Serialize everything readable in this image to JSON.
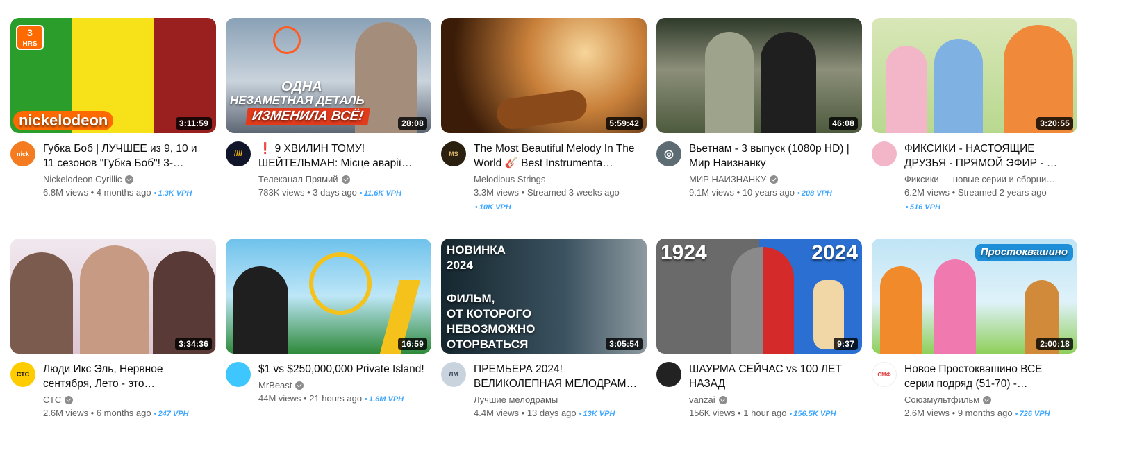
{
  "videos": [
    {
      "title": "Губка Боб | ЛУЧШЕЕ из 9, 10 и 11 сезонов \"Губка Боб\"! 3-…",
      "channel": "Nickelodeon Cyrillic",
      "verified": true,
      "views": "6.8M views",
      "age": "4 months ago",
      "vph": "1.3K VPH",
      "duration": "3:11:59",
      "overlay": [
        "3",
        "HRS",
        "nickelodeon"
      ],
      "avatar_text": "nick",
      "avatar_color": "#f47b20",
      "thumb_colors": [
        "#2a9d2a",
        "#f7e21a",
        "#9a1f1f"
      ]
    },
    {
      "title": "❗ 9 ХВИЛИН ТОМУ! ШЕЙТЕЛЬМАН: Місце аварії…",
      "channel": "Телеканал Прямий",
      "verified": true,
      "views": "783K views",
      "age": "3 days ago",
      "vph": "11.6K VPH",
      "duration": "28:08",
      "overlay": [
        "ОДНА",
        "НЕЗАМЕТНАЯ ДЕТАЛЬ",
        "ИЗМЕНИЛА ВСЁ!"
      ],
      "avatar_text": "////",
      "avatar_color": "#10152a",
      "thumb_colors": [
        "#8aa1b6",
        "#c9d3dc",
        "#e23b1c"
      ]
    },
    {
      "title": "The Most Beautiful Melody In The World 🎸 Best Instrumenta…",
      "channel": "Melodious Strings",
      "verified": false,
      "views": "3.3M views",
      "age": "Streamed 3 weeks ago",
      "vph": "10K VPH",
      "duration": "5:59:42",
      "overlay": [],
      "avatar_text": "MS",
      "avatar_color": "#2b1f0f",
      "thumb_colors": [
        "#3a1c08",
        "#c9803a",
        "#f6d59a"
      ]
    },
    {
      "title": "Вьетнам - 3 выпуск (1080p HD) | Мир Наизнанку",
      "channel": "МИР НАИЗНАНКУ",
      "verified": true,
      "views": "9.1M views",
      "age": "10 years ago",
      "vph": "208 VPH",
      "duration": "46:08",
      "overlay": [],
      "avatar_text": "◎",
      "avatar_color": "#5d6b72",
      "thumb_colors": [
        "#4d5a3d",
        "#8c8f7a",
        "#2f3a2a"
      ]
    },
    {
      "title": "ФИКСИКИ - НАСТОЯЩИЕ ДРУЗЬЯ - ПРЯМОЙ ЭФИР - …",
      "channel": "Фиксики — новые серии и сборни…",
      "verified": false,
      "views": "6.2M views",
      "age": "Streamed 2 years ago",
      "vph": "516 VPH",
      "duration": "3:20:55",
      "overlay": [],
      "avatar_text": "",
      "avatar_color": "#f3b6c9",
      "thumb_colors": [
        "#d9e7b8",
        "#7fb2e3",
        "#f08a3a"
      ]
    },
    {
      "title": "Люди Икс Эль, Нервное сентября, Лето - это…",
      "channel": "СТС",
      "verified": true,
      "views": "2.6M views",
      "age": "6 months ago",
      "vph": "247 VPH",
      "duration": "3:34:36",
      "overlay": [],
      "avatar_text": "СТС",
      "avatar_color": "#ffcc00",
      "thumb_colors": [
        "#f1e8ef",
        "#c79a84",
        "#7a5b4e"
      ]
    },
    {
      "title": "$1 vs $250,000,000 Private Island!",
      "channel": "MrBeast",
      "verified": true,
      "views": "44M views",
      "age": "21 hours ago",
      "vph": "1.6M VPH",
      "duration": "16:59",
      "overlay": [],
      "avatar_text": "",
      "avatar_color": "#3ec6ff",
      "thumb_colors": [
        "#6fc2ec",
        "#2f8a3a",
        "#f4c21a"
      ]
    },
    {
      "title": "ПРЕМЬЕРА 2024! ВЕЛИКОЛЕПНАЯ МЕЛОДРАМ…",
      "channel": "Лучшие мелодрамы",
      "verified": false,
      "views": "4.4M views",
      "age": "13 days ago",
      "vph": "13K VPH",
      "duration": "3:05:54",
      "overlay": [
        "НОВИНКА",
        "2024",
        "ФИЛЬМ,",
        "ОТ КОТОРОГО",
        "НЕВОЗМОЖНО",
        "ОТОРВАТЬСЯ"
      ],
      "avatar_text": "ЛМ",
      "avatar_color": "#c9d3de",
      "thumb_colors": [
        "#15262e",
        "#3b5260",
        "#8d9aa0"
      ]
    },
    {
      "title": "ШАУРМА СЕЙЧАС  vs 100 ЛЕТ НАЗАД",
      "channel": "vanzai",
      "verified": true,
      "views": "156K views",
      "age": "1 hour ago",
      "vph": "156.5K VPH",
      "duration": "9:37",
      "overlay": [
        "1924",
        "2024"
      ],
      "avatar_text": "",
      "avatar_color": "#222222",
      "thumb_colors": [
        "#6a6a6a",
        "#d42a2a",
        "#f2d7a6"
      ]
    },
    {
      "title": "Новое Простоквашино ВСЕ серии подряд (51-70) -…",
      "channel": "Союзмультфильм",
      "verified": true,
      "views": "2.6M views",
      "age": "9 months ago",
      "vph": "726 VPH",
      "duration": "2:00:18",
      "overlay": [
        "Простоквашино"
      ],
      "avatar_text": "СМФ",
      "avatar_color": "#ffffff",
      "thumb_colors": [
        "#bfe4f5",
        "#8fcf5a",
        "#f08a2a"
      ]
    }
  ]
}
